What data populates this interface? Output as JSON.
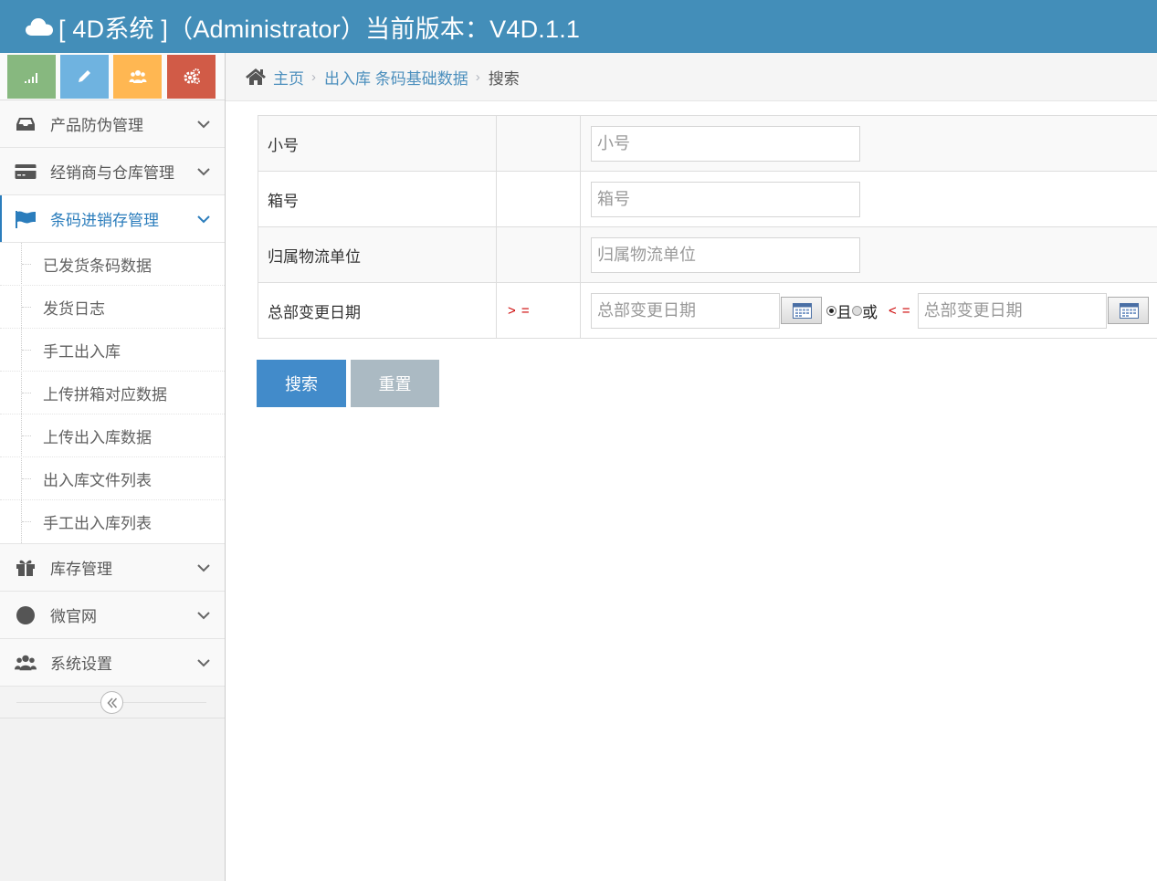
{
  "header": {
    "title": "[ 4D系统 ]（Administrator）当前版本：V4D.1.1"
  },
  "shortcuts": [
    {
      "icon": "signal-icon",
      "color": "#87b87f"
    },
    {
      "icon": "pencil-icon",
      "color": "#6fb3e0"
    },
    {
      "icon": "users-icon",
      "color": "#ffb752"
    },
    {
      "icon": "cogs-icon",
      "color": "#d15b47"
    }
  ],
  "sidebar": {
    "items": [
      {
        "label": "产品防伪管理",
        "icon": "inbox-icon"
      },
      {
        "label": "经销商与仓库管理",
        "icon": "credit-card-icon"
      },
      {
        "label": "条码进销存管理",
        "icon": "flag-icon",
        "open": true,
        "children": [
          "已发货条码数据",
          "发货日志",
          "手工出入库",
          "上传拼箱对应数据",
          "上传出入库数据",
          "出入库文件列表",
          "手工出入库列表"
        ]
      },
      {
        "label": "库存管理",
        "icon": "gift-icon"
      },
      {
        "label": "微官网",
        "icon": "circle-icon"
      },
      {
        "label": "系统设置",
        "icon": "users-icon"
      }
    ]
  },
  "breadcrumb": {
    "home": "主页",
    "parent": "出入库 条码基础数据",
    "current": "搜索"
  },
  "form": {
    "small_no": {
      "label": "小号",
      "placeholder": "小号"
    },
    "box_no": {
      "label": "箱号",
      "placeholder": "箱号"
    },
    "logistics": {
      "label": "归属物流单位",
      "placeholder": "归属物流单位"
    },
    "change_date": {
      "label": "总部变更日期",
      "op_gte": "> =",
      "op_lte": "< =",
      "from_placeholder": "总部变更日期",
      "to_placeholder": "总部变更日期",
      "and_label": "且",
      "or_label": "或",
      "selected": "且"
    }
  },
  "buttons": {
    "search": "搜索",
    "reset": "重置"
  },
  "colors": {
    "navbar": "#438eb9",
    "primary": "#428bca",
    "link": "#4c8fbd",
    "reset": "#abbac3"
  }
}
